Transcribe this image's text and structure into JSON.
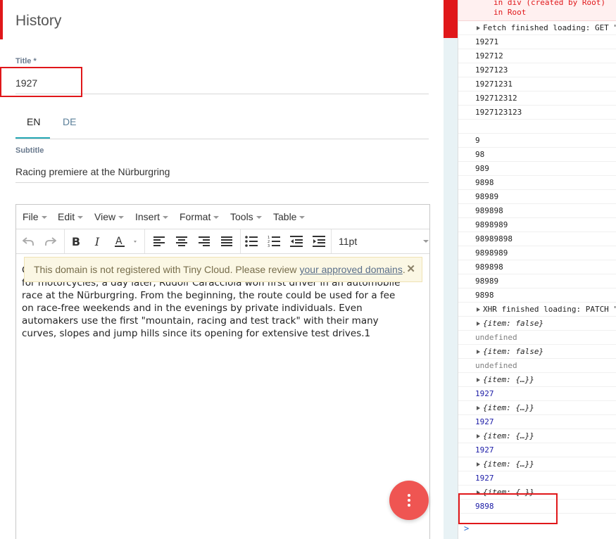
{
  "app": {
    "title": "History",
    "title_label": "Title *",
    "title_value": "1927",
    "tabs": [
      "EN",
      "DE"
    ],
    "subtitle_label": "Subtitle",
    "subtitle_value": "Racing premiere at the Nürburgring",
    "menu": [
      "File",
      "Edit",
      "View",
      "Insert",
      "Format",
      "Tools",
      "Table"
    ],
    "font_size": "11pt",
    "notice_text": "This domain is not registered with Tiny Cloud. Please review",
    "notice_link": "your approved domains",
    "notice_period": ".",
    "body_lines": [
      "C",
      "for motorcycles, a day later, Rudolf Caracciola won first driver in an automobile",
      "race at the Nürburgring. From the beginning, the route could be used for a fee",
      "on race-free weekends and in the evenings by private individuals. Even",
      "automakers use the first \"mountain, racing and test track\" with their many",
      "curves, slopes and jump hills since its opening for extensive test drives.1"
    ]
  },
  "console": {
    "error_lines": [
      "in div (created by Root)",
      "in Root"
    ],
    "rows": [
      {
        "text": "Fetch finished loading: GET \"",
        "kind": "expand"
      },
      {
        "text": "19271",
        "kind": "log"
      },
      {
        "text": "192712",
        "kind": "log"
      },
      {
        "text": "1927123",
        "kind": "log"
      },
      {
        "text": "19271231",
        "kind": "log"
      },
      {
        "text": "192712312",
        "kind": "log"
      },
      {
        "text": "1927123123",
        "kind": "log"
      },
      {
        "text": "",
        "kind": "log"
      },
      {
        "text": "9",
        "kind": "log"
      },
      {
        "text": "98",
        "kind": "log"
      },
      {
        "text": "989",
        "kind": "log"
      },
      {
        "text": "9898",
        "kind": "log"
      },
      {
        "text": "98989",
        "kind": "log"
      },
      {
        "text": "989898",
        "kind": "log"
      },
      {
        "text": "9898989",
        "kind": "log"
      },
      {
        "text": "98989898",
        "kind": "log"
      },
      {
        "text": "9898989",
        "kind": "log"
      },
      {
        "text": "989898",
        "kind": "log"
      },
      {
        "text": "98989",
        "kind": "log"
      },
      {
        "text": "9898",
        "kind": "log"
      },
      {
        "text": "XHR finished loading: PATCH \"",
        "kind": "expand"
      },
      {
        "text": "{item: false}",
        "kind": "expand-obj"
      },
      {
        "text": "undefined",
        "kind": "gray"
      },
      {
        "text": "{item: false}",
        "kind": "expand-obj"
      },
      {
        "text": "undefined",
        "kind": "gray"
      },
      {
        "text": "{item: {…}}",
        "kind": "expand-obj"
      },
      {
        "text": "1927",
        "kind": "blue"
      },
      {
        "text": "{item: {…}}",
        "kind": "expand-obj"
      },
      {
        "text": "1927",
        "kind": "blue"
      },
      {
        "text": "{item: {…}}",
        "kind": "expand-obj"
      },
      {
        "text": "1927",
        "kind": "blue"
      },
      {
        "text": "{item: {…}}",
        "kind": "expand-obj"
      },
      {
        "text": "1927",
        "kind": "blue"
      },
      {
        "text": "{item: {…}}",
        "kind": "expand-obj"
      },
      {
        "text": "9898",
        "kind": "blue"
      }
    ],
    "prompt": ">"
  },
  "colors": {
    "accent_red": "#e0171a",
    "tab_teal": "#26a8b5",
    "fab": "#ef5552",
    "console_blue": "#1a1aa6"
  }
}
